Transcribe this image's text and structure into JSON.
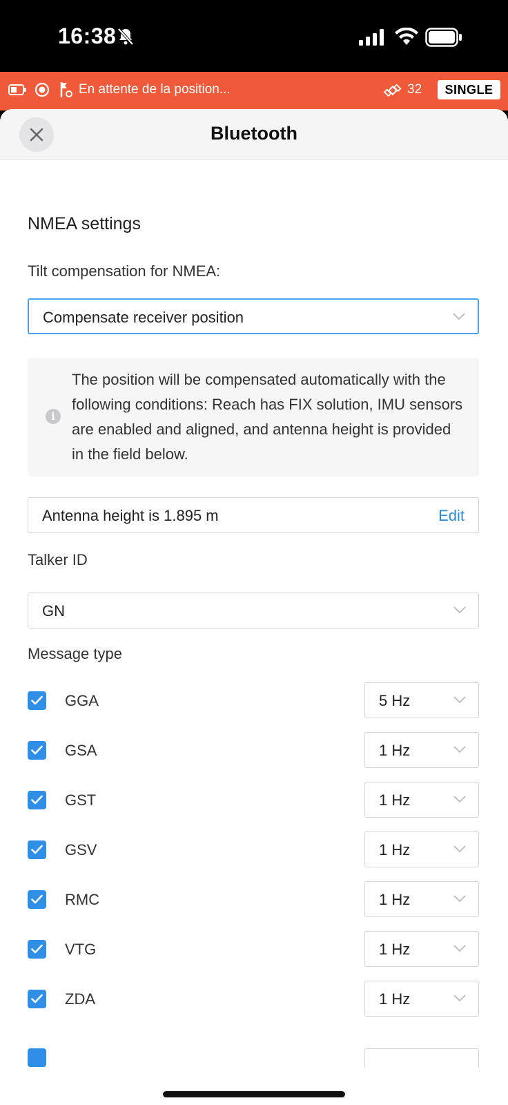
{
  "status_bar": {
    "time": "16:38"
  },
  "banner": {
    "status_text": "En attente de la position...",
    "satellite_count": "32",
    "solution_badge": "SINGLE",
    "accent_color": "#ef5a3a"
  },
  "sheet": {
    "title": "Bluetooth"
  },
  "nmea": {
    "section_title": "NMEA settings",
    "tilt_label": "Tilt compensation for NMEA:",
    "tilt_value": "Compensate receiver position",
    "info_text": "The position will be compensated automatically with the following conditions: Reach has FIX solution, IMU sensors are enabled and aligned, and antenna height is provided in the field below.",
    "antenna_text": "Antenna height is 1.895 m",
    "edit_label": "Edit",
    "talker_label": "Talker ID",
    "talker_value": "GN",
    "message_type_label": "Message type",
    "messages": [
      {
        "name": "GGA",
        "rate": "5 Hz",
        "checked": true
      },
      {
        "name": "GSA",
        "rate": "1 Hz",
        "checked": true
      },
      {
        "name": "GST",
        "rate": "1 Hz",
        "checked": true
      },
      {
        "name": "GSV",
        "rate": "1 Hz",
        "checked": true
      },
      {
        "name": "RMC",
        "rate": "1 Hz",
        "checked": true
      },
      {
        "name": "VTG",
        "rate": "1 Hz",
        "checked": true
      },
      {
        "name": "ZDA",
        "rate": "1 Hz",
        "checked": true
      }
    ]
  }
}
